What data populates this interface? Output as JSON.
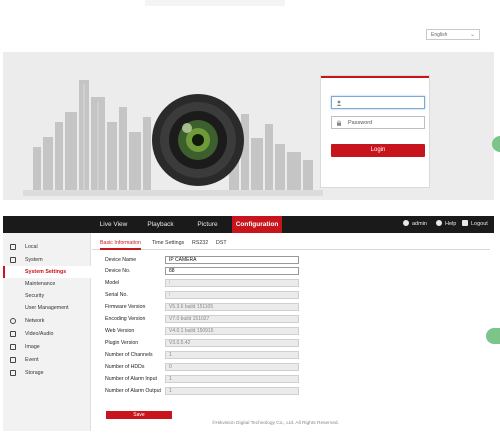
{
  "login": {
    "language": "English",
    "username_placeholder": "",
    "password_placeholder": "Password",
    "login_label": "Login"
  },
  "topnav": {
    "items": [
      "Live View",
      "Playback",
      "Picture",
      "Configuration"
    ],
    "user": "admin",
    "help": "Help",
    "logout": "Logout"
  },
  "sidebar": {
    "items": [
      {
        "label": "Local",
        "icon": "monitor-icon"
      },
      {
        "label": "System",
        "icon": "system-icon"
      },
      {
        "label": "System Settings",
        "icon": ""
      },
      {
        "label": "Maintenance",
        "icon": ""
      },
      {
        "label": "Security",
        "icon": ""
      },
      {
        "label": "User Management",
        "icon": ""
      },
      {
        "label": "Network",
        "icon": "globe-icon"
      },
      {
        "label": "Video/Audio",
        "icon": "video-icon"
      },
      {
        "label": "Image",
        "icon": "image-icon"
      },
      {
        "label": "Event",
        "icon": "event-icon"
      },
      {
        "label": "Storage",
        "icon": "storage-icon"
      }
    ]
  },
  "tabs": [
    "Basic Information",
    "Time Settings",
    "RS232",
    "DST"
  ],
  "fields": [
    {
      "label": "Device Name",
      "value": "IP CAMERA"
    },
    {
      "label": "Device No.",
      "value": "88"
    },
    {
      "label": "Model",
      "value": "I"
    },
    {
      "label": "Serial No.",
      "value": "I"
    },
    {
      "label": "Firmware Version",
      "value": "V5.3.6 build 151105"
    },
    {
      "label": "Encoding Version",
      "value": "V7.0 build 151027"
    },
    {
      "label": "Web Version",
      "value": "V4.0.1 build 150915"
    },
    {
      "label": "Plugin Version",
      "value": "V3.0.5.42"
    },
    {
      "label": "Number of Channels",
      "value": "1"
    },
    {
      "label": "Number of HDDs",
      "value": "0"
    },
    {
      "label": "Number of Alarm Input",
      "value": "1"
    },
    {
      "label": "Number of Alarm Output",
      "value": "1"
    }
  ],
  "save_label": "Save",
  "footer": "©Hikvision Digital Technology Co., Ltd. All Rights Reserved.",
  "colors": {
    "accent": "#c8151d",
    "topbar": "#1a1a1a",
    "sidebar": "#f2f2f2"
  }
}
